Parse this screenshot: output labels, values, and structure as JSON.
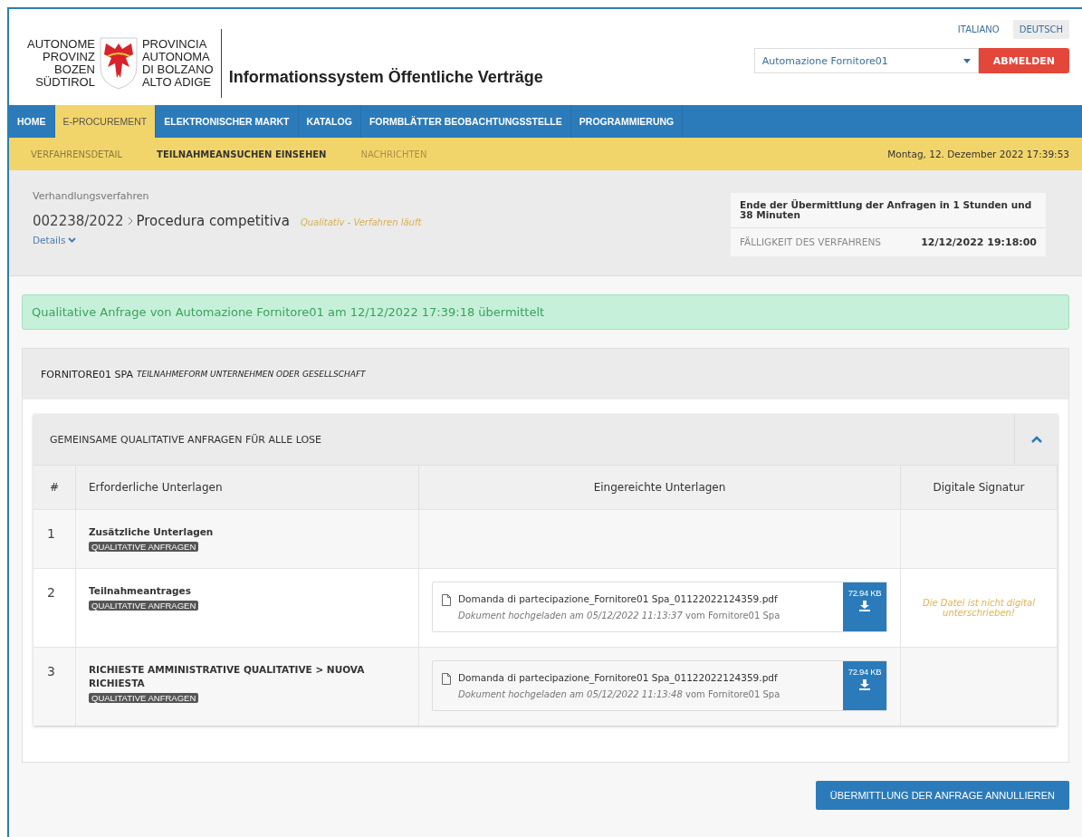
{
  "languages": [
    {
      "label": "ITALIANO",
      "selected": false
    },
    {
      "label": "DEUTSCH",
      "selected": true
    }
  ],
  "logo": {
    "left_lines": [
      "AUTONOME",
      "PROVINZ",
      "BOZEN",
      "SÜDTIROL"
    ],
    "right_lines": [
      "PROVINCIA",
      "AUTONOMA",
      "DI BOLZANO",
      "ALTO ADIGE"
    ]
  },
  "app_title": "Informationssystem Öffentliche Verträge",
  "user_select": {
    "value": "Automazione Fornitore01"
  },
  "logout_button": "ABMELDEN",
  "nav": [
    {
      "label": "HOME",
      "selected": false
    },
    {
      "label": "E-PROCUREMENT",
      "selected": true
    },
    {
      "label": "ELEKTRONISCHER MARKT",
      "selected": false
    },
    {
      "label": "KATALOG",
      "selected": false
    },
    {
      "label": "FORMBLÄTTER BEOBACHTUNGSSTELLE",
      "selected": false
    },
    {
      "label": "PROGRAMMIERUNG",
      "selected": false
    }
  ],
  "subnav": [
    {
      "label": "VERFAHRENSDETAIL",
      "selected": false,
      "disabled": false
    },
    {
      "label": "TEILNAHMEANSUCHEN EINSEHEN",
      "selected": true,
      "disabled": false
    },
    {
      "label": "NACHRICHTEN",
      "selected": false,
      "disabled": true
    }
  ],
  "date": "Montag, 12. Dezember 2022 17:39:53",
  "procedure": {
    "type": "Verhandlungsverfahren",
    "number": "002238/2022",
    "name": "Procedura competitiva",
    "status": "Qualitativ - Verfahren läuft",
    "details_link": "Details"
  },
  "deadline": {
    "remaining": "Ende der Übermittlung der Anfragen in 1 Stunden und 38 Minuten",
    "label": "FÄLLIGKEIT DES VERFAHRENS",
    "value": "12/12/2022 19:18:00"
  },
  "alert": "Qualitative Anfrage von Automazione Fornitore01 am 12/12/2022 17:39:18 übermittelt",
  "company": {
    "name": "FORNITORE01 SPA",
    "form": "TEILNAHMEFORM UNTERNEHMEN ODER GESELLSCHAFT"
  },
  "section": {
    "title": "GEMEINSAME QUALITATIVE ANFRAGEN FÜR ALLE LOSE",
    "expanded": true
  },
  "table": {
    "columns": [
      "#",
      "Erforderliche Unterlagen",
      "Eingereichte Unterlagen",
      "Digitale Signatur"
    ],
    "rows": [
      {
        "number": "1",
        "title": "Zusätzliche Unterlagen",
        "tag": "QUALITATIVE ANFRAGEN",
        "documents": []
      },
      {
        "number": "2",
        "title": "Teilnahmeantrages",
        "tag": "QUALITATIVE ANFRAGEN",
        "documents": [
          {
            "filename": "Domanda di partecipazione_Fornitore01 Spa_01122022124359.pdf",
            "uploaded": "*Dokument hochgeladen am 05/12/2022 11:13:37* vom Fornitore01 Spa",
            "size": "72.94 KB"
          }
        ],
        "signature_note": "Die Datei ist nicht digital unterschrieben!"
      },
      {
        "number": "3",
        "title": "RICHIESTE AMMINISTRATIVE QUALITATIVE > NUOVA RICHIESTA",
        "tag": "QUALITATIVE ANFRAGEN",
        "documents": [
          {
            "filename": "Domanda di partecipazione_Fornitore01 Spa_01122022124359.pdf",
            "uploaded": "*Dokument hochgeladen am 05/12/2022 11:13:48* vom Fornitore01 Spa",
            "size": "72.94 KB"
          }
        ]
      }
    ]
  },
  "cancel_button": "ÜBERMITTLUNG DER ANFRAGE ANNULLIEREN"
}
